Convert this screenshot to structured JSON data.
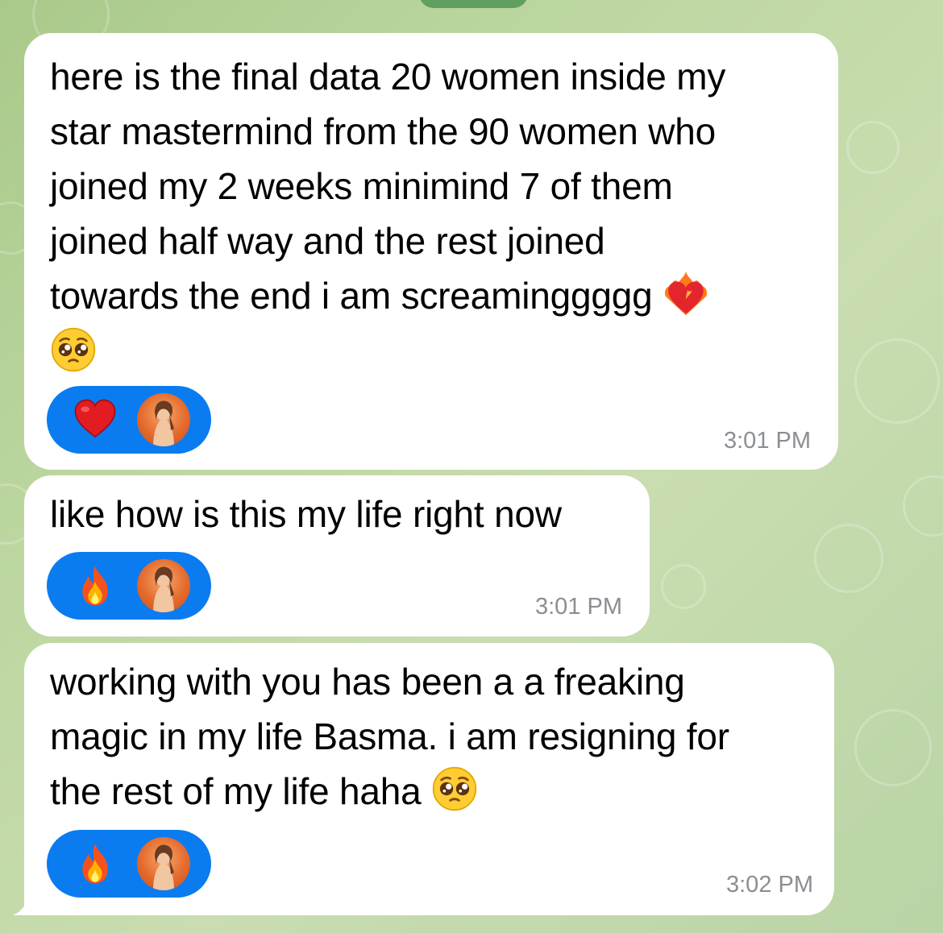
{
  "chat": {
    "messages": [
      {
        "text_lines": [
          "here is the final data 20 women inside my",
          "star mastermind from the 90 women who",
          "joined my 2 weeks minimind 7 of them",
          "joined half way and the rest joined",
          "towards the end i am screaminggggg"
        ],
        "trailing_emoji": "heart-on-fire-icon",
        "extra_emoji": "pleading-face-icon",
        "reaction_emoji": "red-heart-icon",
        "time": "3:01 PM"
      },
      {
        "text_lines": [
          "like how is this my life right now"
        ],
        "reaction_emoji": "fire-icon",
        "time": "3:01 PM"
      },
      {
        "text_lines": [
          "working with you has been a a freaking",
          "magic in my life Basma. i am resigning for",
          "the rest of my life haha"
        ],
        "trailing_emoji": "pleading-face-icon",
        "reaction_emoji": "fire-icon",
        "time": "3:02 PM"
      }
    ]
  },
  "colors": {
    "bubble": "#ffffff",
    "reaction_pill": "#0a7cf0",
    "timestamp": "#8b8e92",
    "wallpaper": "#bcd6a0"
  }
}
